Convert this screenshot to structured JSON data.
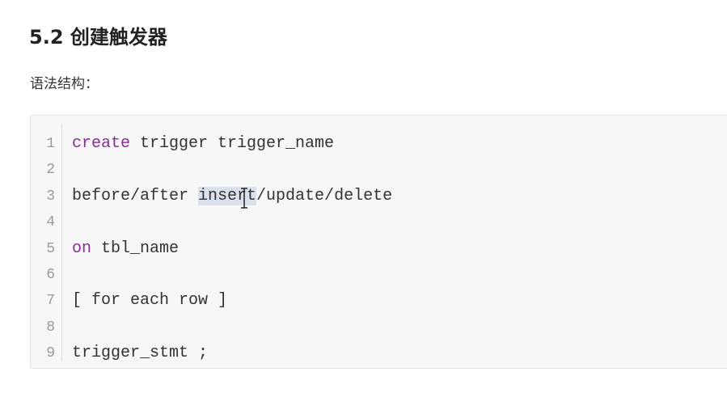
{
  "title": "5.2 创建触发器",
  "subtitle": "语法结构：",
  "code": {
    "line_numbers": [
      "1",
      "2",
      "3",
      "4",
      "5",
      "6",
      "7",
      "8",
      "9"
    ],
    "l1_kw": "create",
    "l1_rest": " trigger trigger_name",
    "l3_a": "before/after ",
    "l3_hl": "insert",
    "l3_b": "/update/delete",
    "l5_kw": "on",
    "l5_rest": " tbl_name",
    "l7": "[ for each row ]",
    "l9": "trigger_stmt ;"
  },
  "colors": {
    "keyword": "#8a2d9a",
    "selection": "#d9e2ec"
  }
}
